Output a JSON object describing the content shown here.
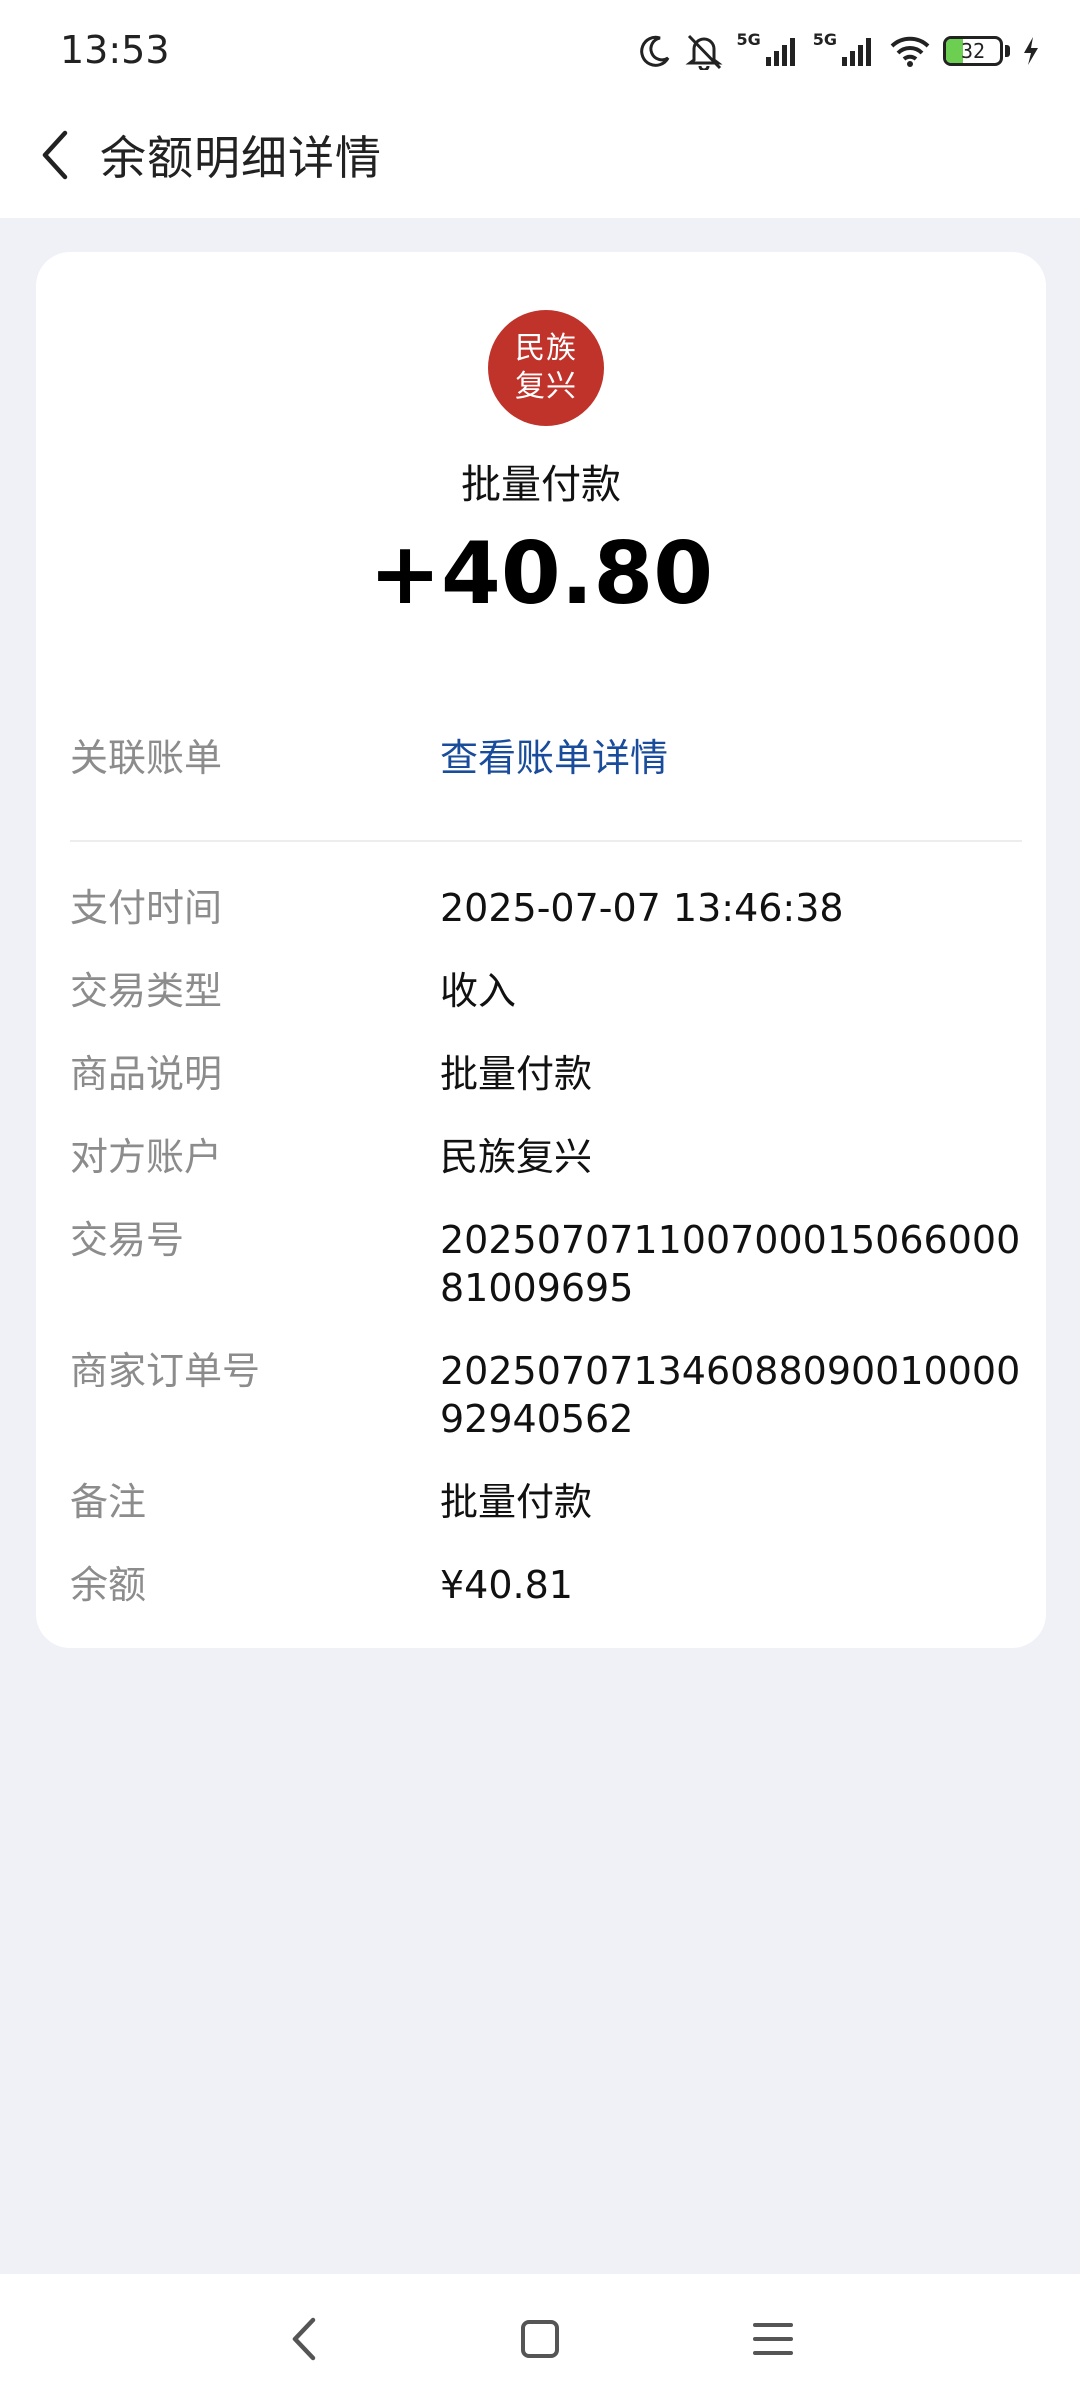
{
  "status_bar": {
    "time": "13:53",
    "network_1": "5G",
    "network_2": "5G",
    "battery_level": "32",
    "battery_fraction": 0.32,
    "icons": [
      "moon-icon",
      "mute-bell-icon",
      "signal-icon",
      "signal-icon",
      "wifi-icon",
      "battery-icon",
      "charging-icon"
    ]
  },
  "header": {
    "back_icon": "chevron-left-icon",
    "title": "余额明细详情"
  },
  "summary": {
    "logo_line1": "民族",
    "logo_line2": "复兴",
    "title": "批量付款",
    "amount": "+40.80"
  },
  "link": {
    "label": "关联账单",
    "value": "查看账单详情"
  },
  "details": [
    {
      "label": "支付时间",
      "value": "2025-07-07 13:46:38"
    },
    {
      "label": "交易类型",
      "value": "收入"
    },
    {
      "label": "商品说明",
      "value": "批量付款"
    },
    {
      "label": "对方账户",
      "value": "民族复兴"
    },
    {
      "label": "交易号",
      "value": "2025070711007000150660008100 9695"
    },
    {
      "label": "商家订单号",
      "value": "20250707134608809001000092940562"
    },
    {
      "label": "备注",
      "value": "批量付款"
    },
    {
      "label": "余额",
      "value": "¥40.81"
    }
  ],
  "navbar": {
    "icons": [
      "nav-back-icon",
      "nav-home-icon",
      "nav-menu-icon"
    ]
  },
  "colors": {
    "background": "#f0f1f6",
    "logo": "#c0332b",
    "link": "#1a4c9c",
    "label": "#8c8c8c"
  }
}
